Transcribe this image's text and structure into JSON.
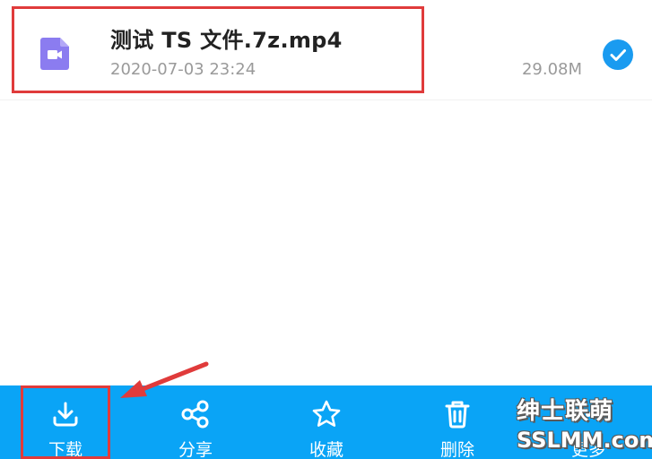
{
  "file": {
    "name": "测试 TS 文件.7z.mp4",
    "date": "2020-07-03 23:24",
    "size": "29.08M",
    "icon": "video-file-icon",
    "selected": true
  },
  "toolbar": {
    "items": [
      {
        "label": "下载",
        "icon": "download-icon"
      },
      {
        "label": "分享",
        "icon": "share-icon"
      },
      {
        "label": "收藏",
        "icon": "star-icon"
      },
      {
        "label": "删除",
        "icon": "trash-icon"
      },
      {
        "label": "更多",
        "icon": "more-icon"
      }
    ]
  },
  "watermark": {
    "line1": "绅士联萌",
    "line2": "SSLMM.com"
  },
  "colors": {
    "toolbar_bg": "#0aa4f6",
    "accent": "#1a9bf0",
    "annotation": "#e03b3b",
    "file_icon": "#8b7cf0"
  }
}
